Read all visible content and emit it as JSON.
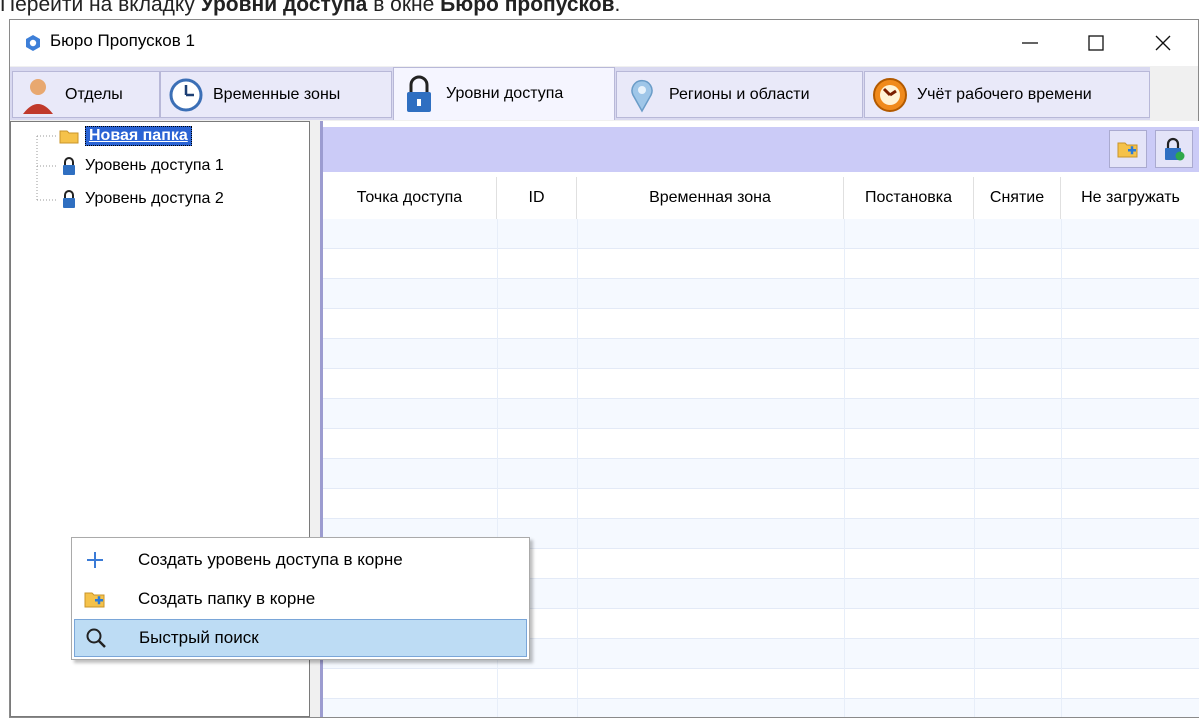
{
  "doc": {
    "prefix": "Перейти на вкладку ",
    "bold1": "Уровни доступа",
    "mid": " в окне ",
    "bold2": "Бюро пропусков",
    "suffix": "."
  },
  "window": {
    "title": "Бюро Пропусков 1",
    "minimize": "—",
    "maximize": "☐",
    "close": "✕"
  },
  "tabs": [
    {
      "label": "Отделы",
      "icon": "person-icon"
    },
    {
      "label": "Временные зоны",
      "icon": "clock-icon"
    },
    {
      "label": "Уровни доступа",
      "icon": "lock-icon",
      "active": true
    },
    {
      "label": "Регионы и области",
      "icon": "map-pin-icon"
    },
    {
      "label": "Учёт рабочего времени",
      "icon": "time-tracking-icon"
    }
  ],
  "tree": {
    "items": [
      {
        "label": "Новая папка",
        "icon": "folder-icon",
        "selected": true
      },
      {
        "label": "Уровень доступа 1",
        "icon": "lock-icon"
      },
      {
        "label": "Уровень доступа 2",
        "icon": "lock-icon"
      }
    ]
  },
  "grid": {
    "columns": [
      "Точка доступа",
      "ID",
      "Временная зона",
      "Постановка",
      "Снятие",
      "Не загружать"
    ],
    "rows": []
  },
  "context_menu": {
    "items": [
      {
        "label": "Создать уровень доступа в корне",
        "icon": "plus-icon"
      },
      {
        "label": "Создать папку в корне",
        "icon": "add-folder-icon"
      },
      {
        "label": "Быстрый поиск",
        "icon": "search-icon",
        "highlighted": true
      }
    ]
  },
  "colors": {
    "accent": "#2a63d4",
    "toolbar": "#cbcbf7",
    "tabstrip": "#d9d9f0",
    "menu_highlight": "#bddcf4"
  }
}
